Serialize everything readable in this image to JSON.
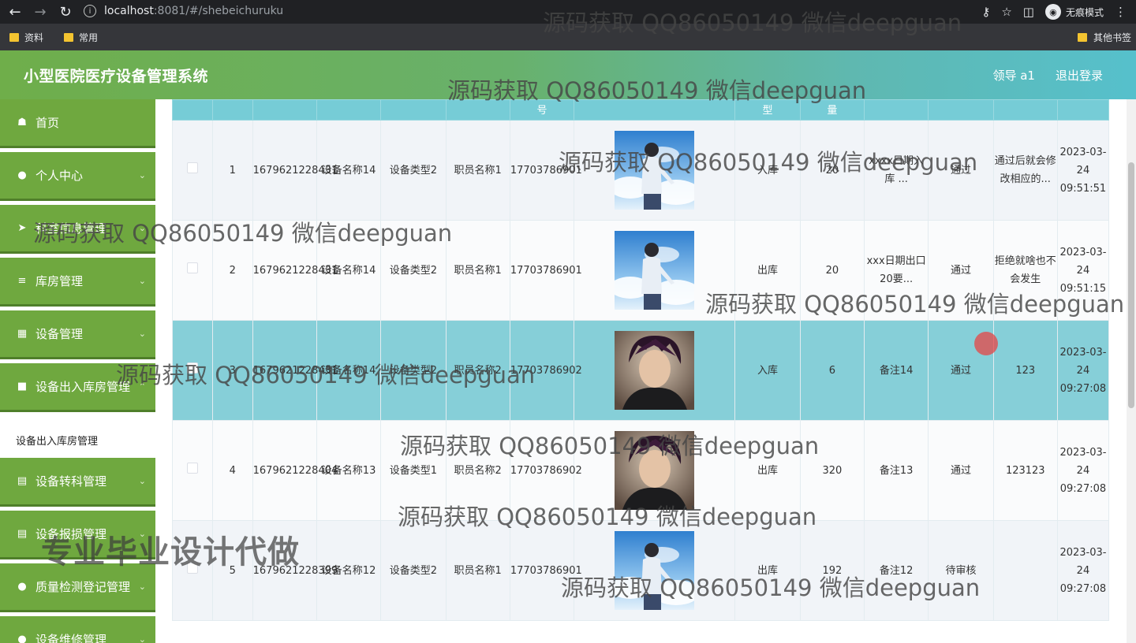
{
  "browser": {
    "url_host": "localhost",
    "url_rest": ":8081/#/shebeichuruku",
    "incognito_label": "无痕模式",
    "bookmarks": [
      "资料",
      "常用"
    ],
    "other_bookmarks": "其他书签"
  },
  "header": {
    "title": "小型医院医疗设备管理系统",
    "user": "领导 a1",
    "logout": "退出登录"
  },
  "sidebar": {
    "items": [
      {
        "label": "首页",
        "icon": "home-icon",
        "chevron": false
      },
      {
        "label": "个人中心",
        "icon": "user-icon",
        "chevron": true
      },
      {
        "label": "科室信息管理",
        "icon": "send-icon",
        "chevron": true
      },
      {
        "label": "库房管理",
        "icon": "menu-icon",
        "chevron": true
      },
      {
        "label": "设备管理",
        "icon": "grid-icon",
        "chevron": true
      },
      {
        "label": "设备出入库房管理",
        "icon": "box-icon",
        "chevron": true
      },
      {
        "label": "设备转科管理",
        "icon": "doc-icon",
        "chevron": true
      },
      {
        "label": "设备报损管理",
        "icon": "doc-icon",
        "chevron": true
      },
      {
        "label": "质量检测登记管理",
        "icon": "user-icon",
        "chevron": true
      },
      {
        "label": "设备维修管理",
        "icon": "user-icon",
        "chevron": true
      }
    ],
    "active_submenu": "设备出入库房管理"
  },
  "table": {
    "header_fragments": [
      "号",
      "型",
      "量"
    ],
    "rows": [
      {
        "index": "1",
        "code": "1679621228431",
        "device_name": "设备名称14",
        "device_type": "设备类型2",
        "staff": "职员名称1",
        "phone": "17703786901",
        "photo": "sky",
        "direction": "入库",
        "qty": "20",
        "note": "xxxx日期入库 ...",
        "status": "通过",
        "reply": "通过后就会修改相应的...",
        "time": "2023-03-24 09:51:51"
      },
      {
        "index": "2",
        "code": "1679621228431",
        "device_name": "设备名称14",
        "device_type": "设备类型2",
        "staff": "职员名称1",
        "phone": "17703786901",
        "photo": "sky",
        "direction": "出库",
        "qty": "20",
        "note": "xxx日期出口20要...",
        "status": "通过",
        "reply": "拒绝就啥也不会发生",
        "time": "2023-03-24 09:51:15"
      },
      {
        "index": "3",
        "code": "1679621228431",
        "device_name": "设备名称14",
        "device_type": "设备类型2",
        "staff": "职员名称2",
        "phone": "17703786902",
        "photo": "portrait",
        "direction": "入库",
        "qty": "6",
        "note": "备注14",
        "status": "通过",
        "reply": "123",
        "time": "2023-03-24 09:27:08"
      },
      {
        "index": "4",
        "code": "1679621228404",
        "device_name": "设备名称13",
        "device_type": "设备类型1",
        "staff": "职员名称2",
        "phone": "17703786902",
        "photo": "portrait",
        "direction": "出库",
        "qty": "320",
        "note": "备注13",
        "status": "通过",
        "reply": "123123",
        "time": "2023-03-24 09:27:08"
      },
      {
        "index": "5",
        "code": "1679621228399",
        "device_name": "设备名称12",
        "device_type": "设备类型2",
        "staff": "职员名称1",
        "phone": "17703786901",
        "photo": "sky",
        "direction": "出库",
        "qty": "192",
        "note": "备注12",
        "status": "待审核",
        "reply": "",
        "time": "2023-03-24 09:27:08"
      }
    ]
  },
  "watermarks": {
    "text": "源码获取 QQ86050149 微信deepguan",
    "big": "专业毕业设计代做"
  },
  "colors": {
    "sidebar_green": "#6fa83f",
    "header_start": "#6fae4a",
    "header_end": "#56c0cc",
    "highlight_row": "#86cfd8"
  }
}
